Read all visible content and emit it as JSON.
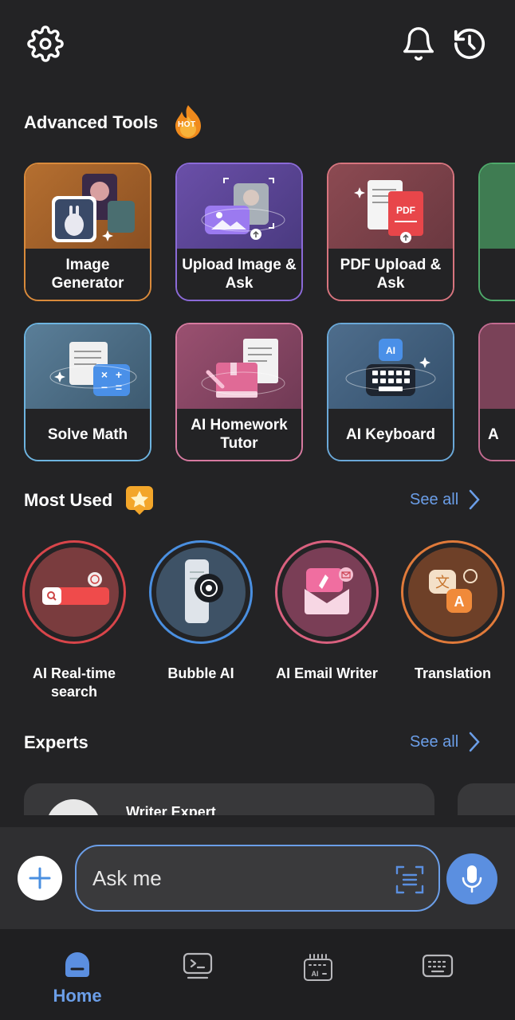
{
  "header": {
    "settings_icon": "gear-icon",
    "notification_icon": "bell-icon",
    "history_icon": "history-clock-icon"
  },
  "advanced_tools": {
    "title": "Advanced Tools",
    "badge": "HOT",
    "row1": [
      {
        "label": "Image Generator",
        "color": "#d98a3b"
      },
      {
        "label": "Upload Image & Ask",
        "color": "#8b6ad8"
      },
      {
        "label": "PDF Upload & Ask",
        "color": "#d7747e"
      },
      {
        "label": "",
        "color": "#4ea86a"
      }
    ],
    "row2": [
      {
        "label": "Solve Math",
        "color": "#6db4e0"
      },
      {
        "label": "AI Homework Tutor",
        "color": "#d77aa0"
      },
      {
        "label": "AI Keyboard",
        "color": "#6aa8d8"
      },
      {
        "label": "A",
        "color": "#c26b90"
      }
    ]
  },
  "most_used": {
    "title": "Most Used",
    "see_all": "See all",
    "items": [
      {
        "label": "AI Real-time search",
        "color": "#d8454a"
      },
      {
        "label": "Bubble AI",
        "color": "#4a8fe0"
      },
      {
        "label": "AI Email Writer",
        "color": "#d9607e"
      },
      {
        "label": "Translation",
        "color": "#e07a3a"
      }
    ]
  },
  "experts": {
    "title": "Experts",
    "see_all": "See all",
    "first_card_name": "Writer Expert"
  },
  "input": {
    "placeholder": "Ask me"
  },
  "nav": {
    "home_label": "Home",
    "accent": "#6b9ee8"
  }
}
